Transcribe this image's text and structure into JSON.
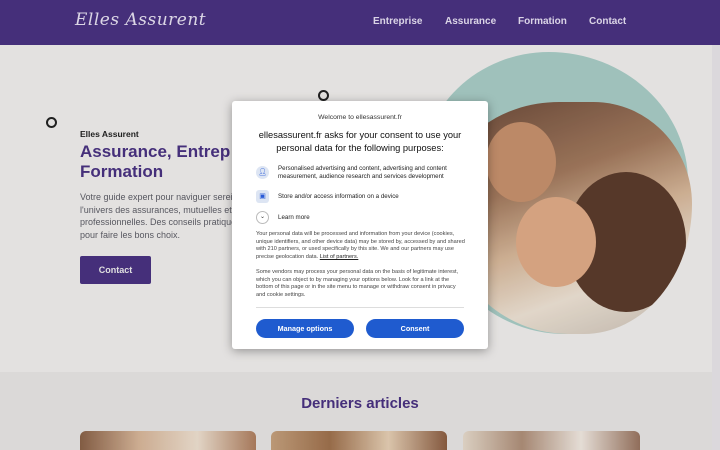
{
  "header": {
    "logo": "Elles Assurent",
    "nav": [
      "Entreprise",
      "Assurance",
      "Formation",
      "Contact"
    ]
  },
  "hero": {
    "eyebrow": "Elles Assurent",
    "title_line1": "Assurance, Entrep",
    "title_line2": "Formation",
    "description": "Votre guide expert pour naviguer serein l'univers des assurances, mutuelles et professionnelles. Des conseils pratiques pour faire les bons choix.",
    "cta": "Contact"
  },
  "articles": {
    "title": "Derniers articles"
  },
  "consent": {
    "welcome": "Welcome to ellesassurent.fr",
    "heading": "ellesassurent.fr asks for your consent to use your personal data for the following purposes:",
    "purposes": [
      {
        "icon": "person-icon",
        "text": "Personalised advertising and content, advertising and content measurement, audience research and services development"
      },
      {
        "icon": "device-icon",
        "text": "Store and/or access information on a device"
      }
    ],
    "learn_more": "Learn more",
    "paragraph1": "Your personal data will be processed and information from your device (cookies, unique identifiers, and other device data) may be stored by, accessed by and shared with 210 partners, or used specifically by this site. We and our partners may use precise geolocation data.",
    "partners_link": "List of partners.",
    "paragraph2": "Some vendors may process your personal data on the basis of legitimate interest, which you can object to by managing your options below. Look for a link at the bottom of this page or in the site menu to manage or withdraw consent in privacy and cookie settings.",
    "manage_button": "Manage options",
    "consent_button": "Consent"
  },
  "colors": {
    "brand": "#4a3282",
    "accent_blue": "#1f5bcf",
    "blob": "#a9cec7"
  }
}
